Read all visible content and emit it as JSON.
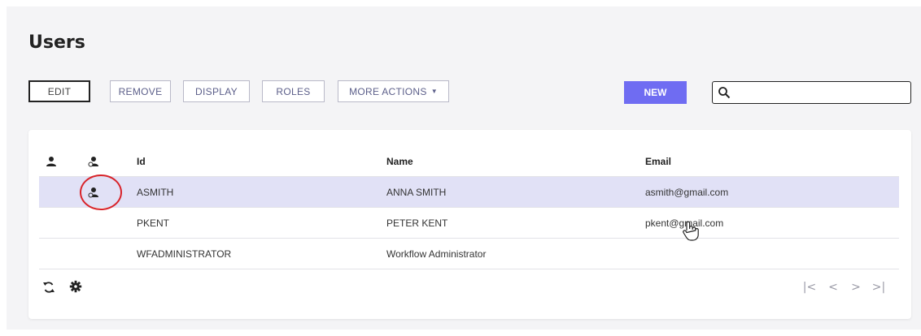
{
  "page": {
    "title": "Users"
  },
  "toolbar": {
    "edit_label": "EDIT",
    "remove_label": "REMOVE",
    "display_label": "DISPLAY",
    "roles_label": "ROLES",
    "more_actions_label": "MORE ACTIONS",
    "new_label": "NEW"
  },
  "search": {
    "value": "",
    "placeholder": ""
  },
  "table": {
    "columns": [
      "Id",
      "Name",
      "Email"
    ],
    "rows": [
      {
        "id": "ASMITH",
        "name": "ANNA SMITH",
        "email": "asmith@gmail.com",
        "selected": true
      },
      {
        "id": "PKENT",
        "name": "PETER KENT",
        "email": "pkent@gmail.com",
        "selected": false
      },
      {
        "id": "WFADMINISTRATOR",
        "name": "Workflow Administrator",
        "email": "",
        "selected": false
      }
    ]
  },
  "pager": {
    "first": "|<",
    "prev": "<",
    "next": ">",
    "last": ">|"
  },
  "colors": {
    "accent": "#6f6cf2",
    "selected_row": "#e1e1f6",
    "highlight_ring": "#d8232a",
    "button_text": "#5c5f8a"
  }
}
